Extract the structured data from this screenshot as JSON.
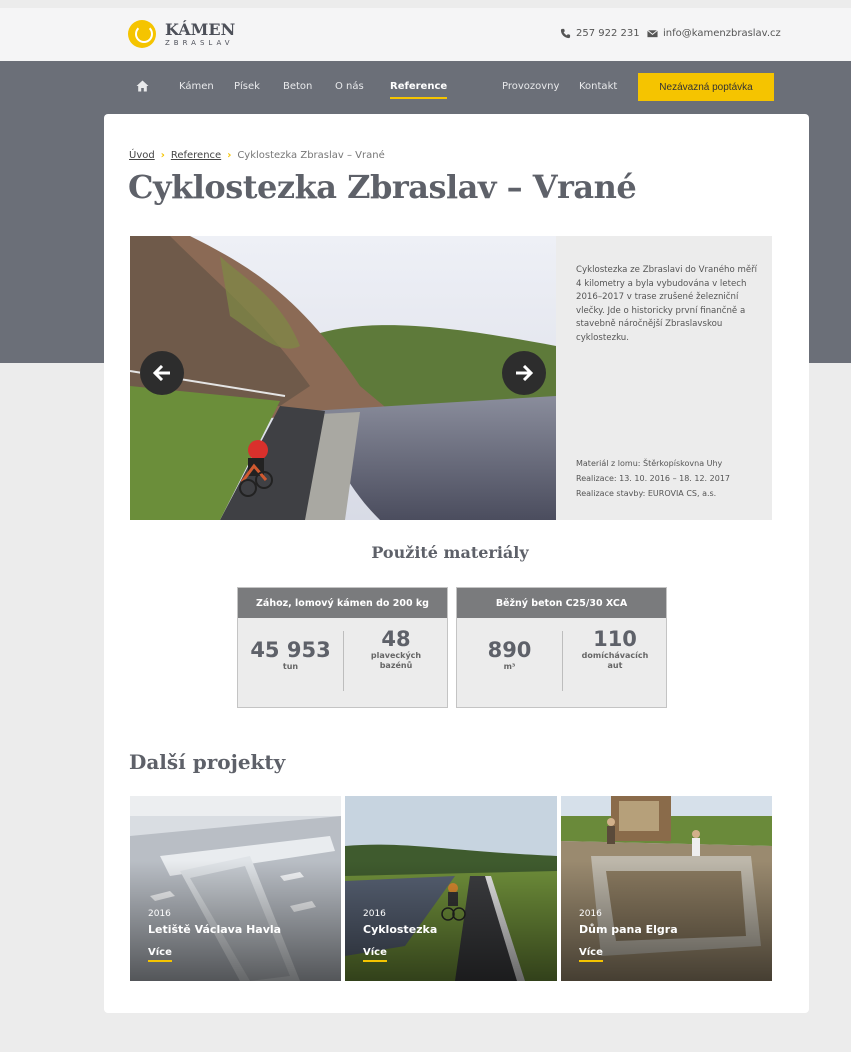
{
  "brand": {
    "title": "KÁMEN",
    "subtitle": "ZBRASLAV"
  },
  "contact": {
    "phone": "257 922 231",
    "email": "info@kamenzbraslav.cz"
  },
  "nav": {
    "items": [
      "Kámen",
      "Písek",
      "Beton",
      "O nás",
      "Reference",
      "Provozovny",
      "Kontakt"
    ],
    "active": "Reference",
    "cta": "Nezávazná poptávka"
  },
  "breadcrumb": [
    "Úvod",
    "Reference",
    "Cyklostezka Zbraslav – Vrané"
  ],
  "page": {
    "title": "Cyklostezka Zbraslav – Vrané"
  },
  "project": {
    "description": "Cyklostezka ze Zbraslavi do Vraného měří 4 kilometry a byla vybudována v letech 2016–2017 v trase zrušené železniční vlečky. Jde o historicky první finančně a stavebně náročnější Zbraslavskou cyklostezku.",
    "meta": [
      "Materiál z lomu: Štěrkopískovna Uhy",
      "Realizace: 13. 10. 2016 – 18. 12. 2017",
      "Realizace stavby: EUROVIA CS, a.s."
    ]
  },
  "materials": {
    "title": "Použité materiály",
    "boxes": [
      {
        "head": "Zához, lomový kámen do 200 kg",
        "left_value": "45 953",
        "left_unit": "tun",
        "right_value": "48",
        "right_unit": "plaveckých bazénů"
      },
      {
        "head": "Běžný beton C25/30 XCA",
        "left_value": "890",
        "left_unit": "m³",
        "right_value": "110",
        "right_unit": "domíchávacích aut"
      }
    ]
  },
  "more": {
    "title": "Další projekty",
    "items": [
      {
        "year": "2016",
        "name": "Letiště Václava Havla",
        "link": "Více"
      },
      {
        "year": "2016",
        "name": "Cyklostezka",
        "link": "Více"
      },
      {
        "year": "2016",
        "name": "Dům pana Elgra",
        "link": "Více"
      }
    ]
  }
}
